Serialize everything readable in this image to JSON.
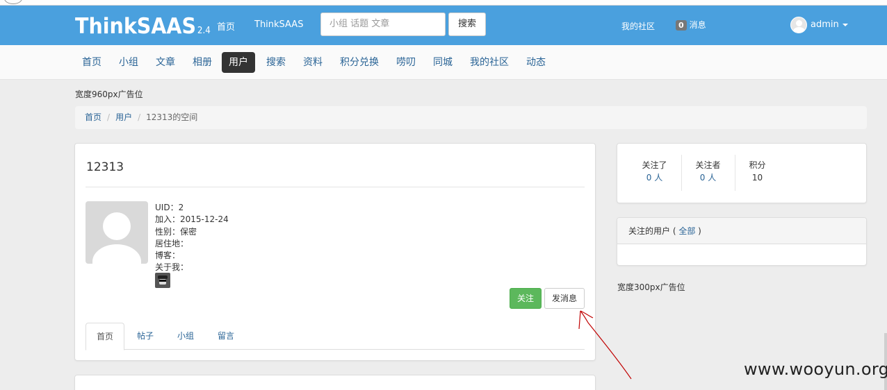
{
  "header": {
    "logo": "ThinkSAAS",
    "version": "2.4",
    "nav": [
      "首页",
      "ThinkSAAS"
    ],
    "search_placeholder": "小组 话题 文章",
    "search_button": "搜索",
    "my_community": "我的社区",
    "message_count": "0",
    "messages": "消息",
    "username": "admin"
  },
  "subnav": {
    "items": [
      "首页",
      "小组",
      "文章",
      "相册",
      "用户",
      "搜索",
      "资料",
      "积分兑换",
      "唠叨",
      "同城",
      "我的社区",
      "动态"
    ],
    "active": "用户"
  },
  "ad_top": "宽度960px广告位",
  "breadcrumb": {
    "items": [
      "首页",
      "用户"
    ],
    "current": "12313的空间"
  },
  "profile": {
    "name": "12313",
    "uid": "UID：2",
    "joined": "加入：2015-12-24",
    "gender": "性别：保密",
    "residence": "居住地：",
    "blog": "博客：",
    "about": "关于我：",
    "follow_button": "关注",
    "message_button": "发消息",
    "tabs": [
      "首页",
      "帖子",
      "小组",
      "留言"
    ]
  },
  "sidebar": {
    "stats": [
      {
        "label": "关注了",
        "value": "0 人"
      },
      {
        "label": "关注者",
        "value": "0 人"
      },
      {
        "label": "积分",
        "value": "10"
      }
    ],
    "followed_users_title": "关注的用户",
    "followed_users_link": "全部",
    "ad": "宽度300px广告位"
  },
  "watermark": "www.wooyun.org",
  "colors": {
    "navbar": "#4aa0de",
    "link": "#2a6496",
    "follow_button": "#5cb85c",
    "annotation": "#c00000"
  }
}
